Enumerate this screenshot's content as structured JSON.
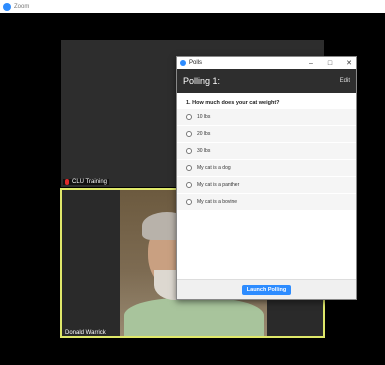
{
  "app": {
    "title": "Zoom"
  },
  "tile1": {
    "participant_name": "CLU Training"
  },
  "tile2": {
    "participant_name": "Donald Warrick"
  },
  "polls_window": {
    "title": "Polls",
    "controls": {
      "minimize": "–",
      "maximize": "□",
      "close": "✕"
    },
    "header": "Polling 1:",
    "edit_label": "Edit",
    "question": "1. How much does your cat weight?",
    "options": [
      "10 lbs",
      "20 lbs",
      "30 lbs",
      "My cat is a dog",
      "My cat is a panther",
      "My cat is a bovine"
    ],
    "launch_label": "Launch Polling"
  },
  "colors": {
    "accent": "#2d8cff",
    "active_speaker": "#dfe86a",
    "muted": "#e02a2a"
  }
}
